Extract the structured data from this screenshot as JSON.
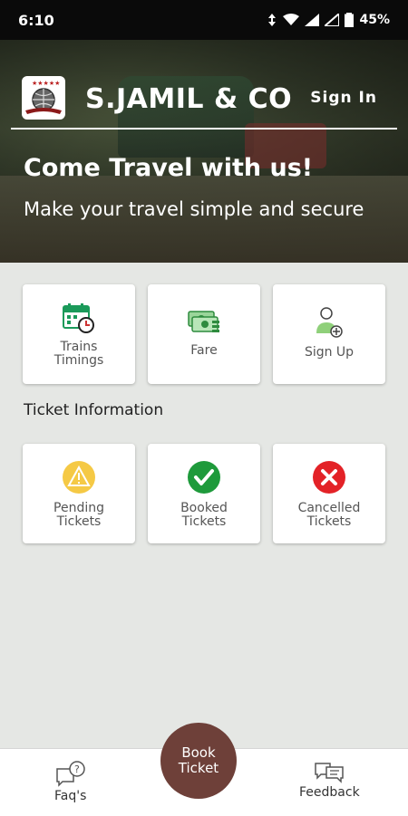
{
  "status_bar": {
    "time": "6:10",
    "battery": "45%"
  },
  "header": {
    "brand": "S.JAMIL & CO",
    "signin": "Sign In"
  },
  "hero": {
    "title": "Come Travel with us!",
    "subtitle": "Make your travel simple and secure"
  },
  "quick_tiles": [
    {
      "label_line1": "Trains",
      "label_line2": "Timings",
      "icon": "calendar-clock-icon"
    },
    {
      "label_line1": "Fare",
      "label_line2": "",
      "icon": "cash-icon"
    },
    {
      "label_line1": "Sign Up",
      "label_line2": "",
      "icon": "add-user-icon"
    }
  ],
  "ticket_section": {
    "title": "Ticket Information"
  },
  "ticket_tiles": [
    {
      "label_line1": "Pending",
      "label_line2": "Tickets",
      "icon": "warning-icon",
      "color": "#f5c945"
    },
    {
      "label_line1": "Booked",
      "label_line2": "Tickets",
      "icon": "check-icon",
      "color": "#1e9a3b"
    },
    {
      "label_line1": "Cancelled",
      "label_line2": "Tickets",
      "icon": "cross-icon",
      "color": "#e32227"
    }
  ],
  "bottom_nav": {
    "faqs": "Faq's",
    "book_line1": "Book",
    "book_line2": "Ticket",
    "feedback": "Feedback"
  },
  "colors": {
    "primary": "#6e4039"
  }
}
